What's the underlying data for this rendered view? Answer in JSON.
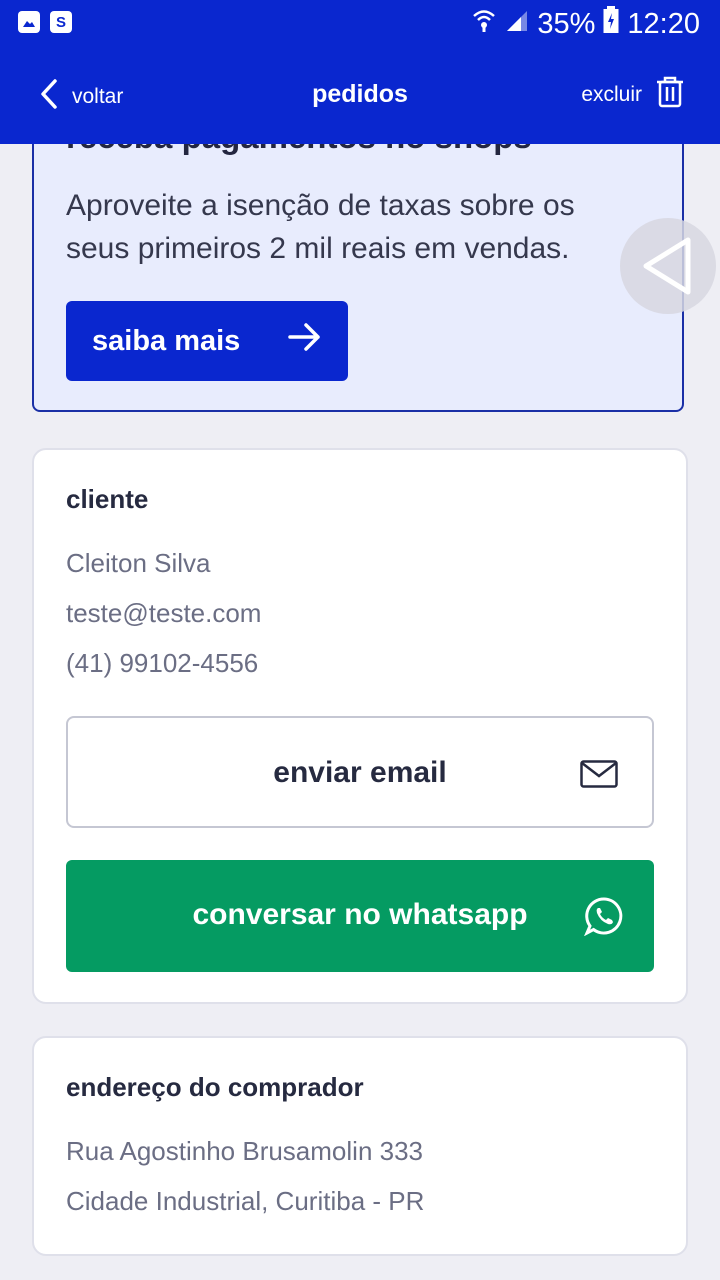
{
  "status_bar": {
    "left_icons": [
      "image-icon",
      "s-app-icon"
    ],
    "s_app_letter": "S",
    "battery": "35%",
    "time": "12:20"
  },
  "app_bar": {
    "back_label": "voltar",
    "title": "pedidos",
    "delete_label": "excluir"
  },
  "promo": {
    "heading": "receba pagamentos no shops",
    "text": "Aproveite a isenção de taxas sobre os seus primeiros 2 mil reais em vendas.",
    "button_label": "saiba mais"
  },
  "client": {
    "title": "cliente",
    "name": "Cleiton Silva",
    "email": "teste@teste.com",
    "phone": "(41) 99102-4556",
    "email_button": "enviar email",
    "whatsapp_button": "conversar no whatsapp"
  },
  "address": {
    "title": "endereço do comprador",
    "line1": "Rua Agostinho Brusamolin 333",
    "line2": "Cidade Industrial, Curitiba - PR"
  },
  "colors": {
    "primary": "#0a27cf",
    "whatsapp": "#059b62",
    "background": "#eeeef4",
    "promo_bg": "#e8ecfd"
  }
}
